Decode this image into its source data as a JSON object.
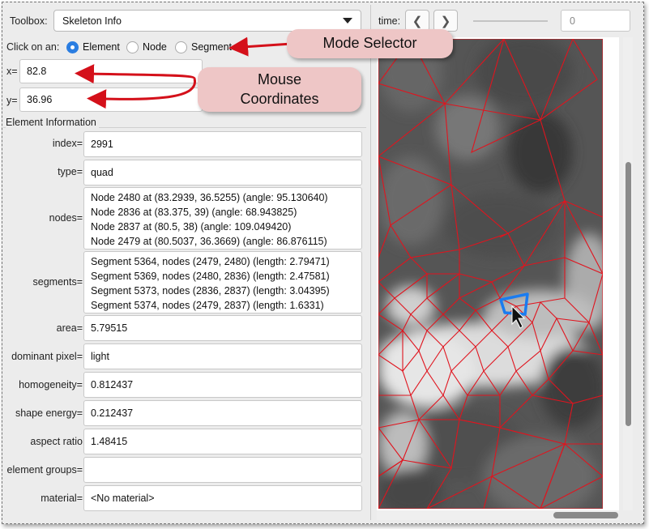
{
  "toolbox": {
    "label": "Toolbox:",
    "selected": "Skeleton Info"
  },
  "click_on": {
    "label": "Click on an:",
    "options": [
      "Element",
      "Node",
      "Segment"
    ],
    "selected": "Element"
  },
  "coords": {
    "x_label": "x=",
    "x_value": "82.8",
    "y_label": "y=",
    "y_value": "36.96"
  },
  "element_info": {
    "title": "Element Information",
    "index_label": "index=",
    "index_value": "2991",
    "type_label": "type=",
    "type_value": "quad",
    "nodes_label": "nodes=",
    "nodes": [
      "Node 2480 at (83.2939, 36.5255) (angle: 95.130640)",
      "Node 2836 at (83.375, 39) (angle: 68.943825)",
      "Node 2837 at (80.5, 38) (angle: 109.049420)",
      "Node 2479 at (80.5037, 36.3669) (angle: 86.876115)"
    ],
    "segments_label": "segments=",
    "segments": [
      "Segment 5364, nodes (2479, 2480) (length: 2.79471)",
      "Segment 5369, nodes (2480, 2836) (length: 2.47581)",
      "Segment 5373, nodes (2836, 2837) (length: 3.04395)",
      "Segment 5374, nodes (2479, 2837) (length: 1.6331)"
    ],
    "area_label": "area=",
    "area_value": "5.79515",
    "dominant_pixel_label": "dominant pixel=",
    "dominant_pixel_value": "light",
    "homogeneity_label": "homogeneity=",
    "homogeneity_value": "0.812437",
    "shape_energy_label": "shape energy=",
    "shape_energy_value": "0.212437",
    "aspect_ratio_label": "aspect ratio",
    "aspect_ratio_value": "1.48415",
    "element_groups_label": "element groups=",
    "element_groups_value": "",
    "material_label": "material=",
    "material_value": "<No material>"
  },
  "time_bar": {
    "label": "time:",
    "prev_icon": "chevron-left-icon",
    "next_icon": "chevron-right-icon",
    "value_placeholder": "0"
  },
  "annotations": {
    "mode_selector": "Mode Selector",
    "mouse_coords_line1": "Mouse",
    "mouse_coords_line2": "Coordinates"
  },
  "colors": {
    "mesh_red": "#e0141e",
    "selection_blue": "#1a7cf0",
    "callout_fill": "#eec6c6",
    "arrow_red": "#d4101a"
  }
}
